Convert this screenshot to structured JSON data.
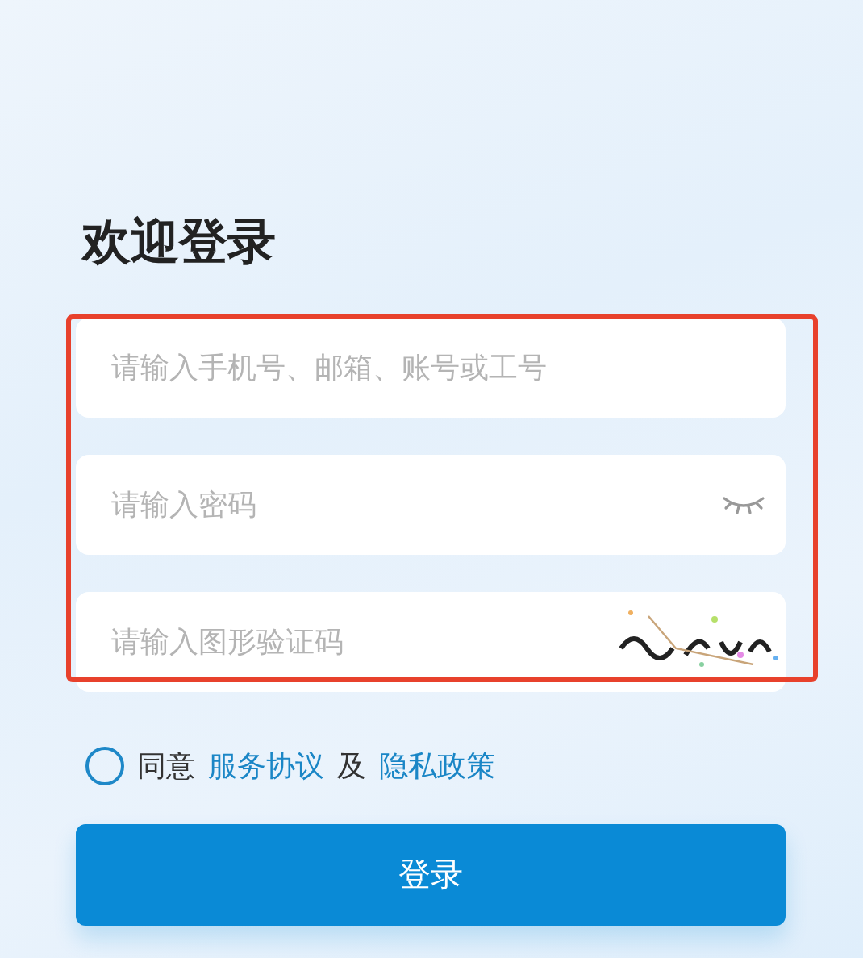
{
  "title": "欢迎登录",
  "fields": [
    {
      "kind": "text",
      "placeholder": "请输入手机号、邮箱、账号或工号"
    },
    {
      "kind": "password",
      "placeholder": "请输入密码"
    },
    {
      "kind": "captcha",
      "placeholder": "请输入图形验证码"
    }
  ],
  "agreement": {
    "checked": false,
    "parts": [
      {
        "kind": "text",
        "text": "同意"
      },
      {
        "kind": "link",
        "text": "服务协议"
      },
      {
        "kind": "text",
        "text": "及"
      },
      {
        "kind": "link",
        "text": "隐私政策"
      }
    ]
  },
  "login_button": "登录"
}
